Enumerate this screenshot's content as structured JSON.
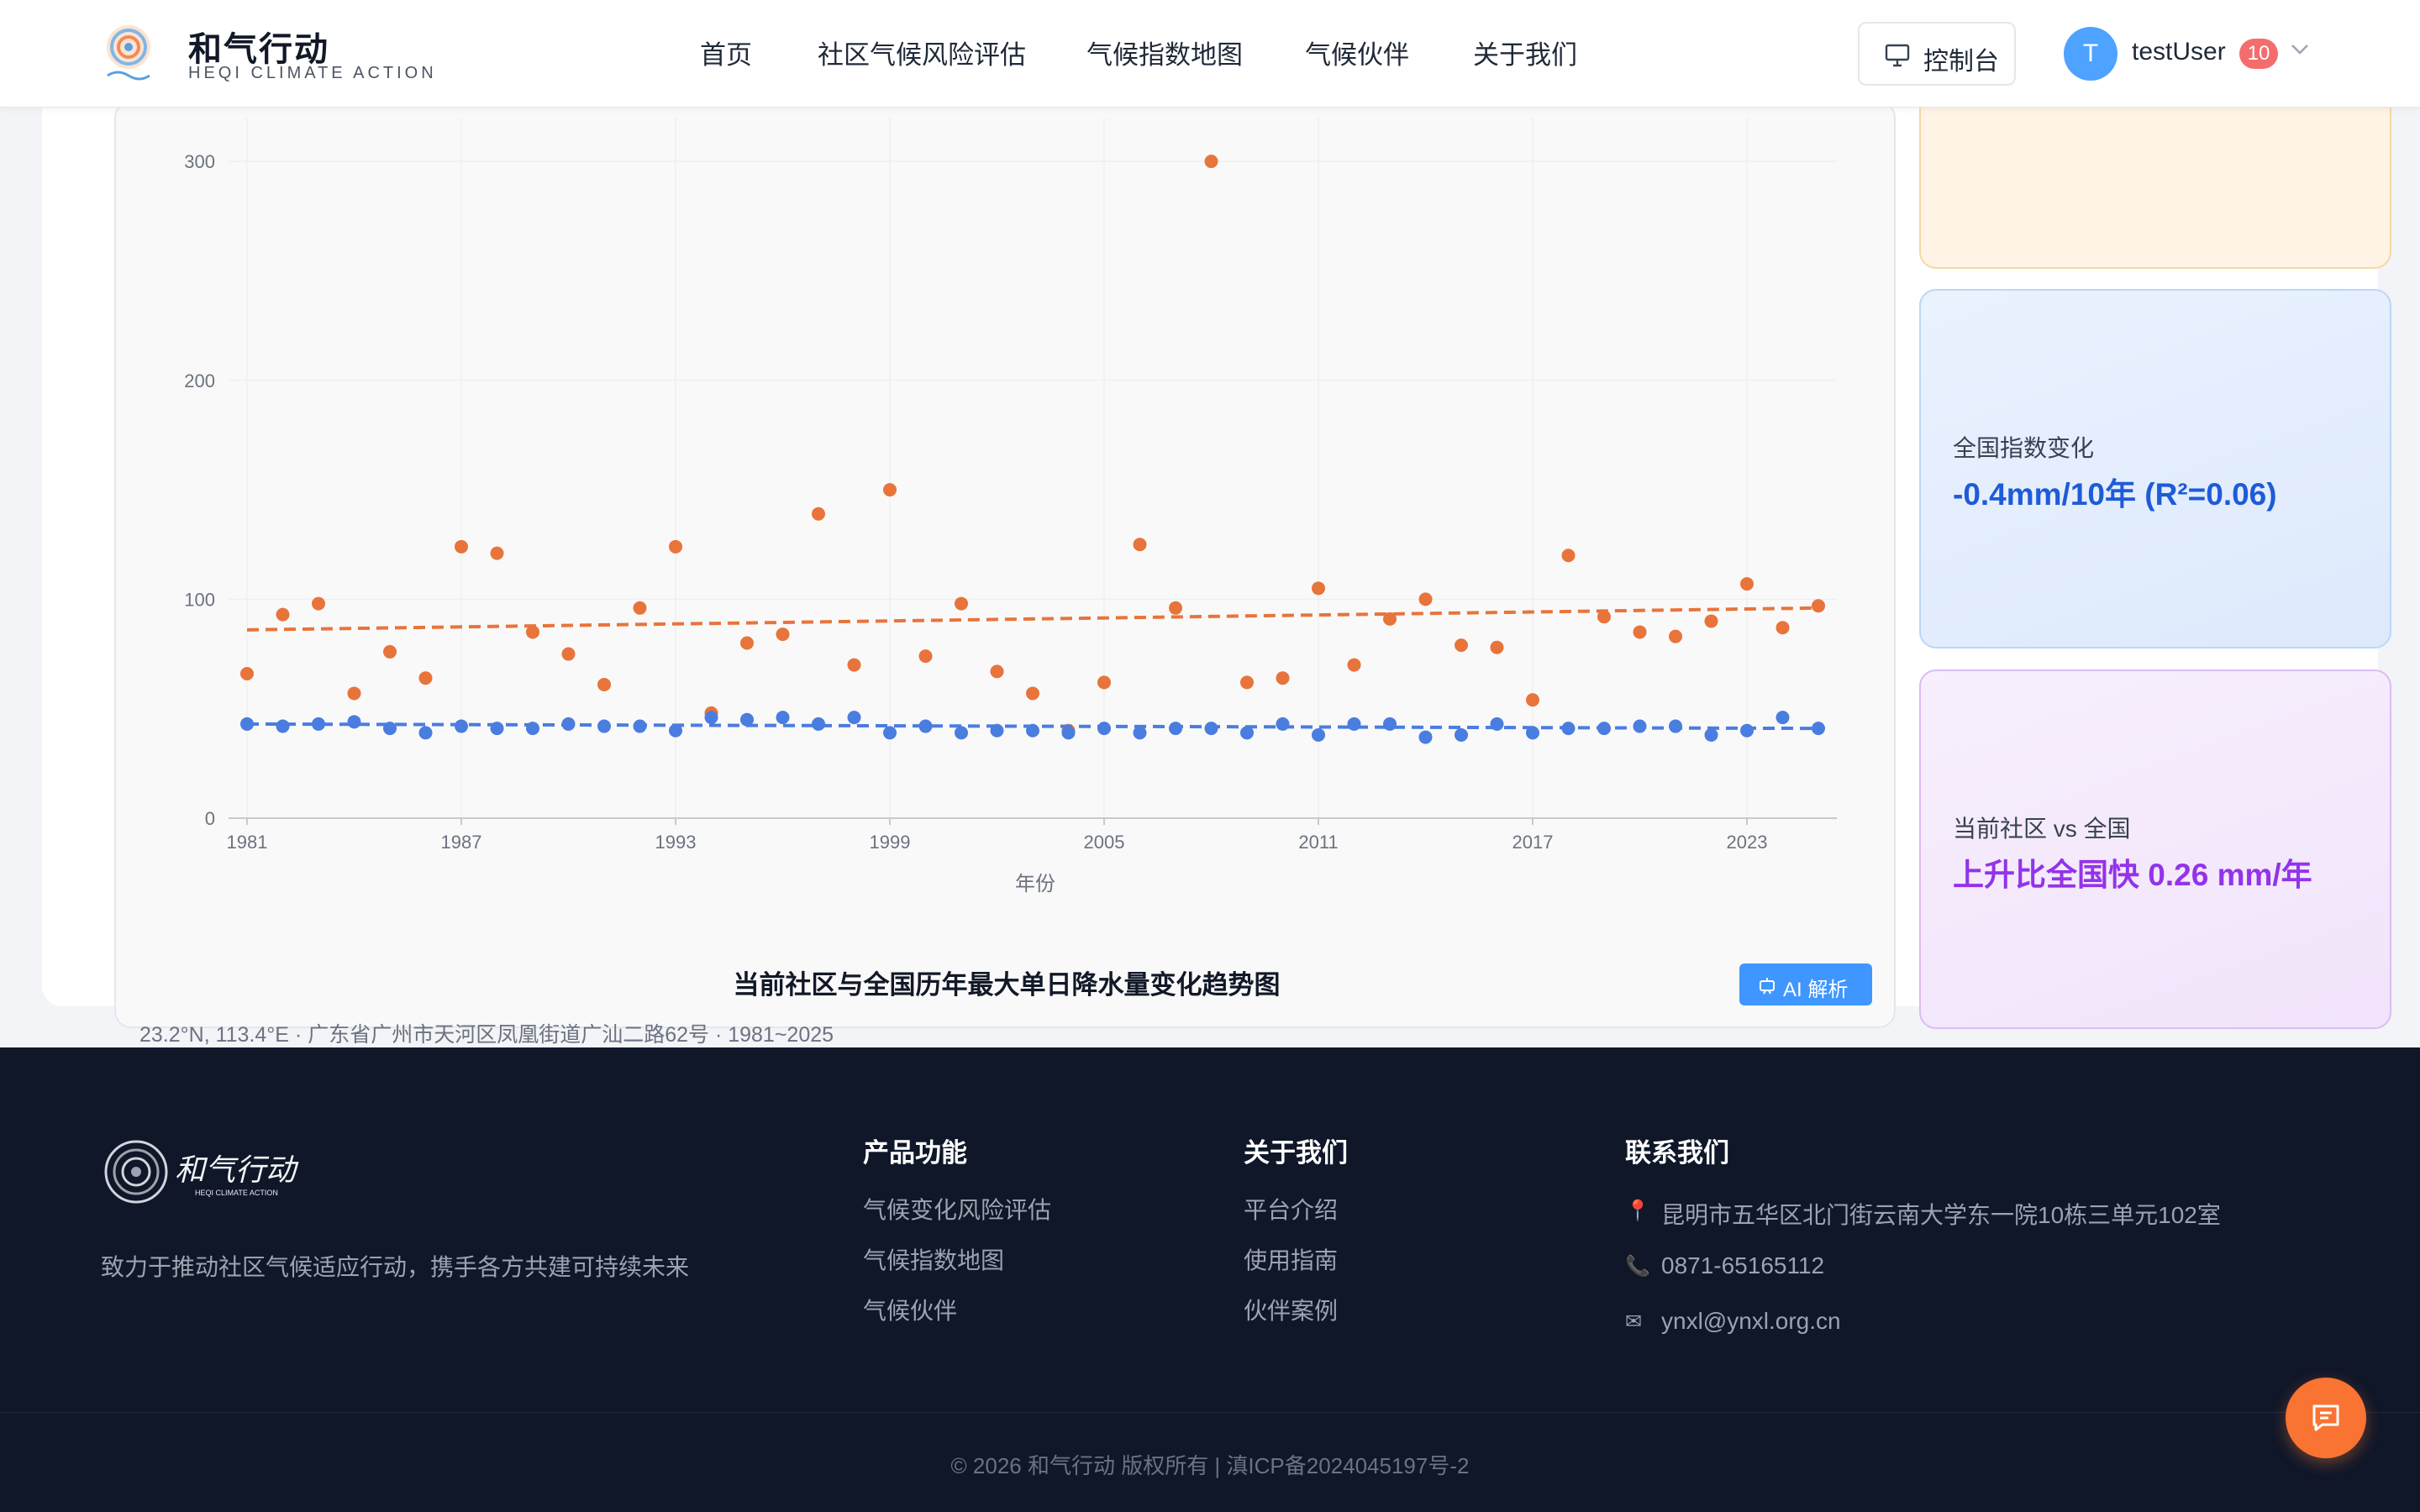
{
  "header": {
    "brand_title": "和气行动",
    "brand_subtitle": "HEQI CLIMATE ACTION",
    "nav": [
      "首页",
      "社区气候风险评估",
      "气候指数地图",
      "气候伙伴",
      "关于我们"
    ],
    "console_label": "控制台",
    "avatar_letter": "T",
    "username": "testUser",
    "notification_count": "10"
  },
  "chart": {
    "title": "当前社区与全国历年最大单日降水量变化趋势图",
    "meta": "23.2°N, 113.4°E · 广东省广州市天河区凤凰街道广汕二路62号 · 1981~2025",
    "ai_button": "AI 解析",
    "xlabel_partial": "年份"
  },
  "chart_data": {
    "type": "scatter",
    "x": [
      1981,
      1982,
      1983,
      1984,
      1985,
      1986,
      1987,
      1988,
      1989,
      1990,
      1991,
      1992,
      1993,
      1994,
      1995,
      1996,
      1997,
      1998,
      1999,
      2000,
      2001,
      2002,
      2003,
      2004,
      2005,
      2006,
      2007,
      2008,
      2009,
      2010,
      2011,
      2012,
      2013,
      2014,
      2015,
      2016,
      2017,
      2018,
      2019,
      2020,
      2021,
      2022,
      2023,
      2024,
      2025
    ],
    "xticks": [
      "1981",
      "1987",
      "1993",
      "1999",
      "2005",
      "2011",
      "2017",
      "2023"
    ],
    "yticks": [
      "0",
      "100",
      "200",
      "300"
    ],
    "ylim": [
      0,
      320
    ],
    "grid": true,
    "series": [
      {
        "color": "#e8743b",
        "values": [
          66,
          93,
          98,
          57,
          76,
          64,
          124,
          121,
          85,
          75,
          61,
          96,
          124,
          48,
          80,
          84,
          139,
          70,
          150,
          74,
          98,
          67,
          57,
          40,
          62,
          125,
          96,
          300,
          62,
          64,
          105,
          70,
          91,
          100,
          79,
          78,
          54,
          120,
          92,
          85,
          83,
          90,
          107,
          87,
          97
        ],
        "trend": [
          86,
          96
        ]
      },
      {
        "color": "#4a7de0",
        "values": [
          43,
          42,
          43,
          44,
          41,
          39,
          42,
          41,
          41,
          43,
          42,
          42,
          40,
          46,
          45,
          46,
          43,
          46,
          39,
          42,
          39,
          40,
          40,
          39,
          41,
          39,
          41,
          41,
          39,
          43,
          38,
          43,
          43,
          37,
          38,
          43,
          39,
          41,
          41,
          42,
          42,
          38,
          40,
          46,
          41
        ],
        "trend": [
          43,
          41
        ]
      }
    ]
  },
  "side_cards": {
    "orange": {},
    "national": {
      "label": "全国指数变化",
      "value": "-0.4mm/10年 (R²=0.06)",
      "color": "#1e5bd8"
    },
    "compare": {
      "label": "当前社区 vs 全国",
      "value": "上升比全国快 0.26 mm/年",
      "color": "#9333ea"
    }
  },
  "footer": {
    "tagline": "致力于推动社区气候适应行动，携手各方共建可持续未来",
    "product_title": "产品功能",
    "product_links": [
      "气候变化风险评估",
      "气候指数地图",
      "气候伙伴"
    ],
    "about_title": "关于我们",
    "about_links": [
      "平台介绍",
      "使用指南",
      "伙伴案例"
    ],
    "contact_title": "联系我们",
    "address": "昆明市五华区北门街云南大学东一院10栋三单元102室",
    "phone": "0871-65165112",
    "email": "ynxl@ynxl.org.cn",
    "copyright": "© 2026 和气行动 版权所有   |   滇ICP备2024045197号-2",
    "logo_text": "和气行动",
    "logo_subtext": "HEQI CLIMATE ACTION"
  }
}
